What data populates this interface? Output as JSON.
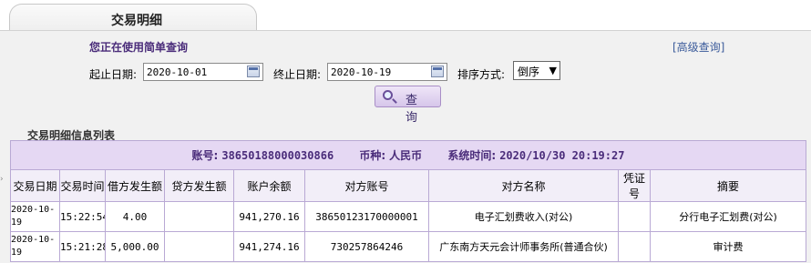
{
  "tab": {
    "title": "交易明细"
  },
  "query": {
    "mode_text": "您正在使用简单查询",
    "advanced_link": "[高级查询]",
    "start_label": "起止日期:",
    "start_value": "2020-10-01",
    "end_label": "终止日期:",
    "end_value": "2020-10-19",
    "sort_label": "排序方式:",
    "sort_value": "倒序",
    "search_button": "查 询"
  },
  "list": {
    "title": "交易明细信息列表",
    "summary": {
      "account_label": "账号:",
      "account_value": "38650188000030866",
      "currency_label": "币种:",
      "currency_value": "人民币",
      "systime_label": "系统时间:",
      "systime_value": "2020/10/30 20:19:27"
    },
    "columns": [
      "交易日期",
      "交易时间",
      "借方发生额",
      "贷方发生额",
      "账户余额",
      "对方账号",
      "对方名称",
      "凭证号",
      "摘要"
    ],
    "rows": [
      {
        "date": "2020-10-19",
        "time": "15:22:54",
        "debit": "4.00",
        "credit": "",
        "balance": "941,270.16",
        "cp_account": "38650123170000001",
        "cp_name": "电子汇划费收入(对公)",
        "voucher": "",
        "summary": "分行电子汇划费(对公)"
      },
      {
        "date": "2020-10-19",
        "time": "15:21:28",
        "debit": "5,000.00",
        "credit": "",
        "balance": "941,274.16",
        "cp_account": "730257864246",
        "cp_name": "广东南方天元会计师事务所(普通合伙)",
        "voucher": "",
        "summary": "审计费"
      }
    ]
  }
}
